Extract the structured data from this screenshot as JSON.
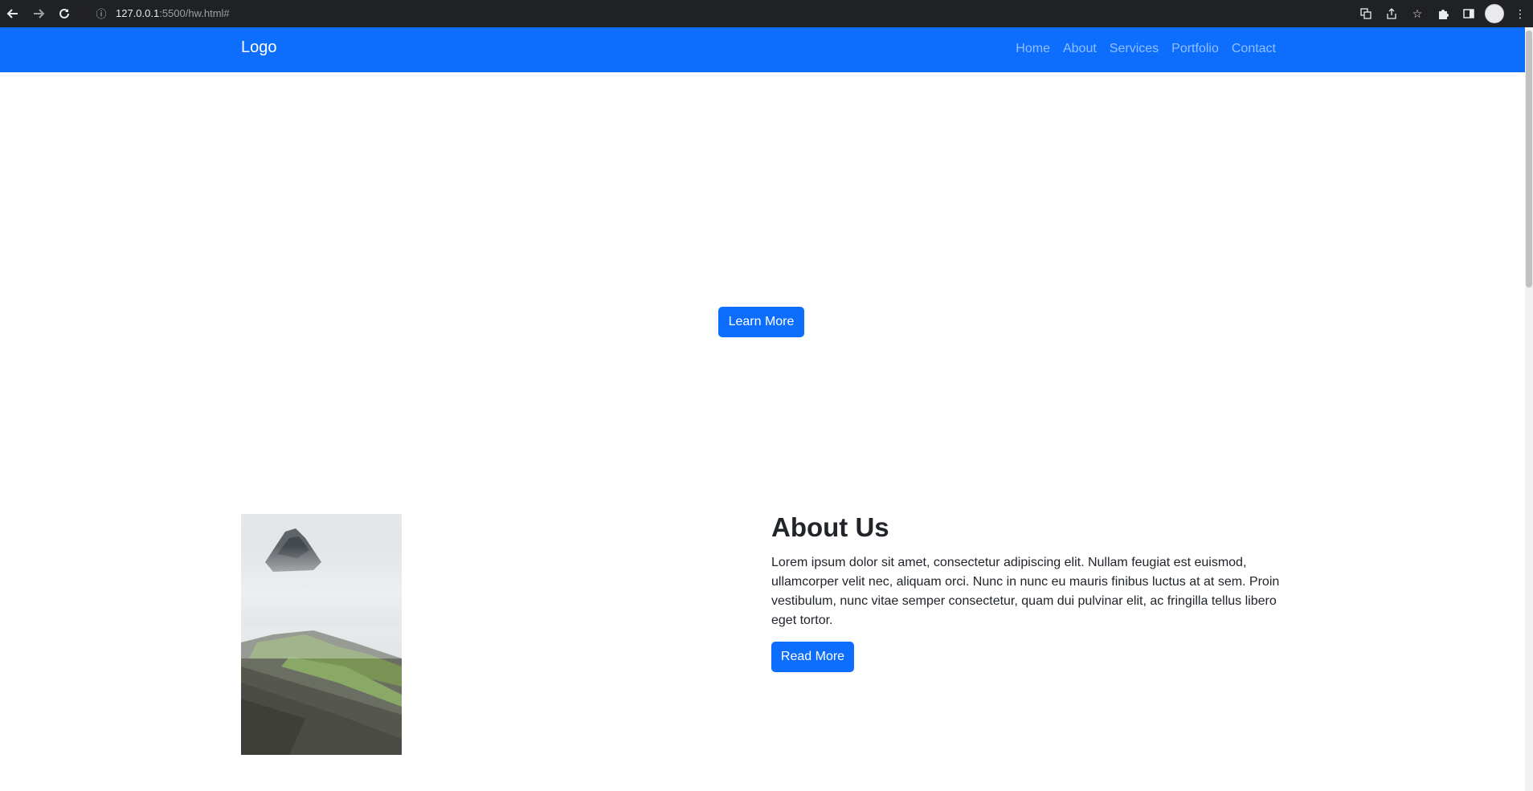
{
  "browser": {
    "url_host": "127.0.0.1",
    "url_path": ":5500/hw.html#"
  },
  "navbar": {
    "brand": "Logo",
    "links": [
      "Home",
      "About",
      "Services",
      "Portfolio",
      "Contact"
    ]
  },
  "hero": {
    "button_label": "Learn More"
  },
  "about": {
    "title": "About Us",
    "text": "Lorem ipsum dolor sit amet, consectetur adipiscing elit. Nullam feugiat est euismod, ullamcorper velit nec, aliquam orci. Nunc in nunc eu mauris finibus luctus at at sem. Proin vestibulum, nunc vitae semper consectetur, quam dui pulvinar elit, ac fringilla tellus libero eget tortor.",
    "button_label": "Read More"
  },
  "colors": {
    "primary": "#0d6efd",
    "chrome": "#202124"
  }
}
